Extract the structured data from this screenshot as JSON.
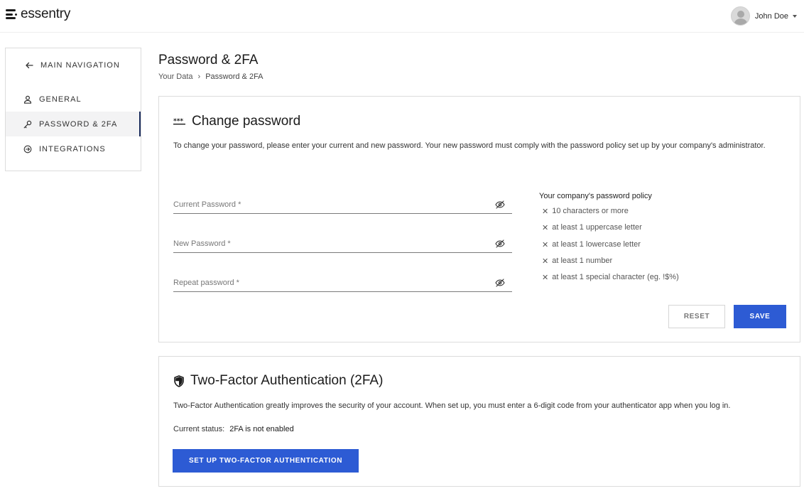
{
  "app": {
    "logo_text": "essentry"
  },
  "user": {
    "name": "John Doe"
  },
  "sidebar": {
    "items": [
      {
        "label": "MAIN NAVIGATION",
        "icon": "arrow-left-icon"
      },
      {
        "label": "GENERAL",
        "icon": "user-icon"
      },
      {
        "label": "PASSWORD & 2FA",
        "icon": "key-icon",
        "active": true
      },
      {
        "label": "INTEGRATIONS",
        "icon": "integrations-icon"
      }
    ]
  },
  "page": {
    "title": "Password & 2FA",
    "breadcrumb": [
      "Your Data",
      "Password & 2FA"
    ]
  },
  "change_password": {
    "title": "Change password",
    "description": "To change your password, please enter your current and new password. Your new password must comply with the password policy set up by your company's administrator.",
    "fields": [
      {
        "placeholder": "Current Password *",
        "value": ""
      },
      {
        "placeholder": "New Password *",
        "value": ""
      },
      {
        "placeholder": "Repeat password *",
        "value": ""
      }
    ],
    "policy": {
      "title": "Your company's password policy",
      "rules": [
        "10 characters or more",
        "at least 1 uppercase letter",
        "at least 1 lowercase letter",
        "at least 1 number",
        "at least 1 special character (eg. !$%)"
      ]
    },
    "reset_label": "RESET",
    "save_label": "SAVE"
  },
  "two_factor": {
    "title": "Two-Factor Authentication (2FA)",
    "description": "Two-Factor Authentication greatly improves the security of your account. When set up, you must enter a 6-digit code from your authenticator app when you log in.",
    "status_label": "Current status:",
    "status_value": "2FA is not enabled",
    "setup_label": "SET UP TWO-FACTOR AUTHENTICATION"
  },
  "colors": {
    "primary": "#2d5bd4",
    "active_indicator": "#1a2b5c"
  }
}
